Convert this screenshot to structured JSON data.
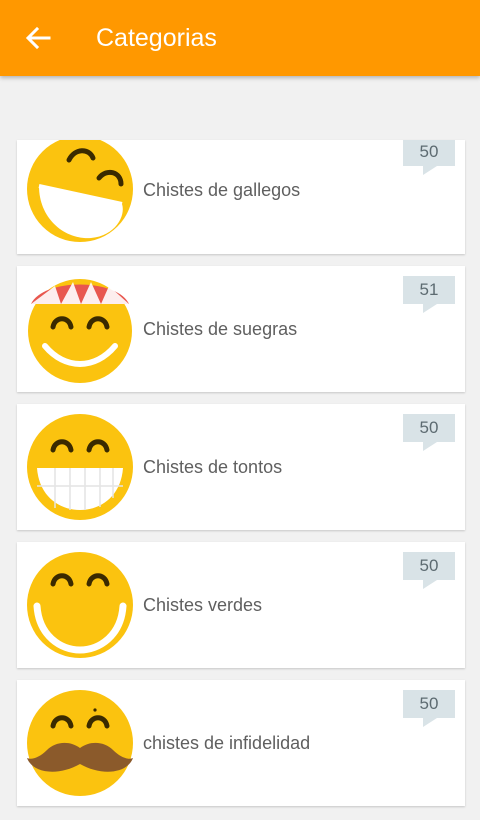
{
  "appbar": {
    "title": "Categorias",
    "color": "#ff9800",
    "back_icon": "arrow-left-icon"
  },
  "categories": [
    {
      "label": "Chistes de gallegos",
      "count": "50",
      "face": "laughing-face-icon"
    },
    {
      "label": "Chistes de suegras",
      "count": "51",
      "face": "smiling-face-with-cap-icon"
    },
    {
      "label": "Chistes de tontos",
      "count": "50",
      "face": "grinning-teeth-face-icon"
    },
    {
      "label": "Chistes verdes",
      "count": "50",
      "face": "big-smile-face-icon"
    },
    {
      "label": "chistes de infidelidad",
      "count": "50",
      "face": "mustache-face-icon"
    }
  ],
  "colors": {
    "face": "#fbc30f",
    "badge_bg": "#d9e3e7",
    "badge_text": "#5d6b71"
  }
}
